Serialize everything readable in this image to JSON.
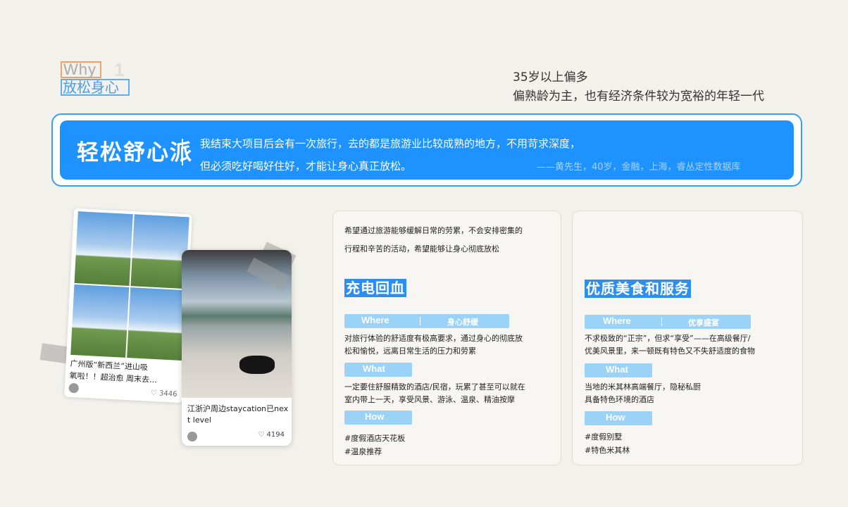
{
  "header": {
    "why": "Why",
    "num": "1",
    "subtitle": "放松身心",
    "demo_line1": "35岁以上偏多",
    "demo_line2": "偏熟龄为主，也有经济条件较为宽裕的年轻一代"
  },
  "banner": {
    "title": "轻松舒心派",
    "quote_line1": "我结束大项目后会有一次旅行，去的都是旅游业比较成熟的地方，不用苛求深度，",
    "quote_line2": "但必须吃好喝好住好，才能让身心真正放松。",
    "source": "——黄先生，40岁，金融，上海，睿丛定性数据库"
  },
  "cards": {
    "card1": {
      "caption_l1": "广州版“新西兰”进山吸",
      "caption_l2": "氧啦！！超治愈 周末去…",
      "likes": "3446"
    },
    "card2": {
      "caption_l1": "江浙沪周边staycation已nex",
      "caption_l2": "t level",
      "likes": "4194"
    }
  },
  "left_panel": {
    "intro_l1": "希望通过旅游能够缓解日常的劳累，不会安排密集的",
    "intro_l2": "行程和辛苦的活动，希望能够让身心彻底放松",
    "title": "充电回血",
    "where_key": "Where",
    "where_val": "身心舒缓",
    "where_text_l1": "对旅行体验的舒适度有极高要求，通过身心的彻底放",
    "where_text_l2": "松和愉悦，远离日常生活的压力和劳累",
    "what_key": "What",
    "what_text_l1": "一定要住舒服精致的酒店/民宿，玩累了甚至可以就在",
    "what_text_l2": "室内带上一天，享受风景、游泳、温泉、精油按摩",
    "how_key": "How",
    "how_text_l1": "#度假酒店天花板",
    "how_text_l2": "#温泉推荐"
  },
  "right_panel": {
    "title": "优质美食和服务",
    "where_key": "Where",
    "where_val": "优享盛宴",
    "where_text_l1": "不求极致的“正宗”，但求“享受”——在高级餐厅/",
    "where_text_l2": "优美风景里，来一顿既有特色又不失舒适度的食物",
    "what_key": "What",
    "what_text_l1": "当地的米其林高端餐厅，隐秘私厨",
    "what_text_l2": "具备特色环境的酒店",
    "how_key": "How",
    "how_text_l1": "#度假别墅",
    "how_text_l2": "#特色米其林"
  },
  "colors": {
    "accent": "#1e93ff",
    "pill": "#9ad3f7",
    "orange_box": "#f0a06a"
  }
}
